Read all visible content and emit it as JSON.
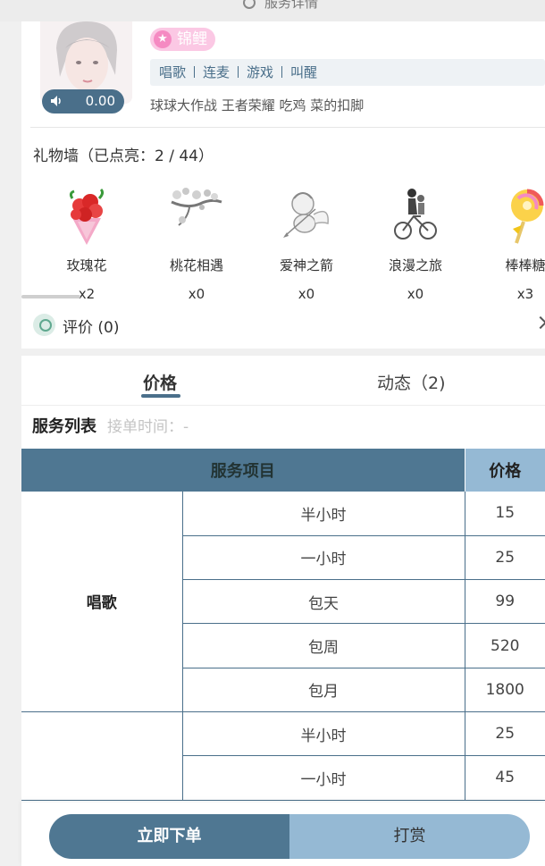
{
  "header": {
    "title": "服务详情"
  },
  "profile": {
    "voice_duration": "0.00",
    "badge": "锦鲤",
    "tags": [
      "唱歌",
      "连麦",
      "游戏",
      "叫醒"
    ],
    "games": "球球大作战 王者荣耀 吃鸡 菜的扣脚"
  },
  "gift_wall": {
    "title": "礼物墙（已点亮：2 / 44）",
    "gifts": [
      {
        "name": "玫瑰花",
        "count": "x2",
        "icon": "rose-bouquet"
      },
      {
        "name": "桃花相遇",
        "count": "x0",
        "icon": "peach-blossom-branch"
      },
      {
        "name": "爱神之箭",
        "count": "x0",
        "icon": "cupid"
      },
      {
        "name": "浪漫之旅",
        "count": "x0",
        "icon": "bicycle-couple"
      },
      {
        "name": "棒棒糖",
        "count": "x3",
        "icon": "lollipop"
      }
    ]
  },
  "review": {
    "label": "评价 (0)"
  },
  "tabs": {
    "price": "价格",
    "dynamics": "动态（2)"
  },
  "service": {
    "title": "服务列表",
    "accept_time": "接单时间：-",
    "columns": [
      "服务项目",
      "价格"
    ],
    "groups": [
      {
        "category": "唱歌",
        "rows": [
          {
            "item": "半小时",
            "price": "15"
          },
          {
            "item": "一小时",
            "price": "25"
          },
          {
            "item": "包天",
            "price": "99"
          },
          {
            "item": "包周",
            "price": "520"
          },
          {
            "item": "包月",
            "price": "1800"
          }
        ]
      },
      {
        "category": "",
        "rows": [
          {
            "item": "半小时",
            "price": "25"
          },
          {
            "item": "一小时",
            "price": "45"
          }
        ]
      }
    ]
  },
  "actions": {
    "order": "立即下单",
    "tip": "打赏"
  },
  "colors": {
    "accent": "#4f7792",
    "accent_light": "#95b9d4",
    "badge_pink": "#fbc8e4"
  }
}
